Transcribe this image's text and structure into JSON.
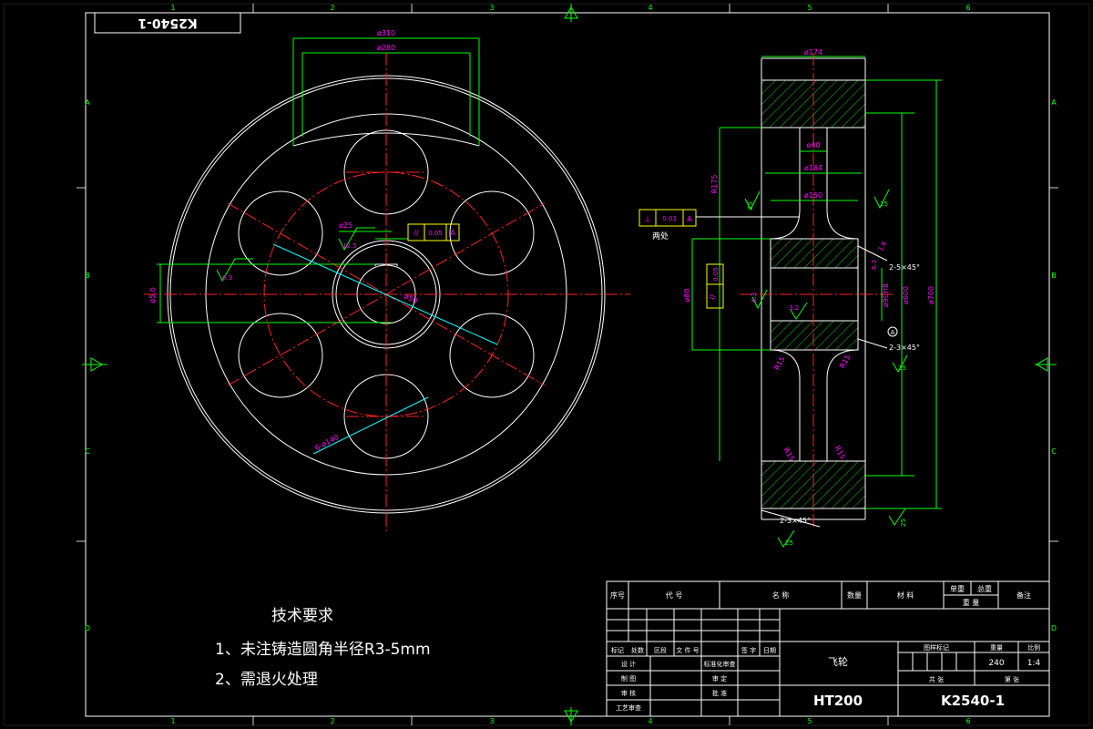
{
  "colors": {
    "background": "#000000",
    "outline": "#ffffff",
    "center": "#ff2020",
    "dimension": "#00ff00",
    "dim_text": "#ff00ff",
    "leader": "#00ffff",
    "symbol": "#ffff00",
    "hatch": "#00ff00"
  },
  "border": {
    "columns": [
      "1",
      "2",
      "3",
      "4",
      "5",
      "6"
    ],
    "rows": [
      "A",
      "B",
      "C",
      "D"
    ]
  },
  "drawing_code_box": "K2540-1",
  "front_view": {
    "dims": {
      "d310": "ø310",
      "d280": "ø280",
      "d25": "ø25",
      "d5_6": "ø5.6",
      "holes": "6-ø140",
      "d_center": "ø50"
    },
    "roughness": {
      "r12_5": "12.5",
      "r6_3": "6.3"
    },
    "tolerance_frame": [
      "//",
      "0.05",
      "A"
    ]
  },
  "section_view": {
    "dims": {
      "d174": "ø174",
      "d40": "ø40",
      "d164": "ø164",
      "d150": "ø150",
      "r175": "R175",
      "d90h8": "ø90H8",
      "d600": "ø600",
      "d700": "ø700",
      "d80": "ø80",
      "r15_a": "R15",
      "r15_b": "R15",
      "r15_c": "R15",
      "r15_d": "R15",
      "chamfer_a": "2-5×45°",
      "chamfer_b": "2-3×45°",
      "chamfer_c": "2-3×45°"
    },
    "roughness": {
      "r25_a": "25",
      "r25_b": "25",
      "r25_c": "25",
      "r25_d": "25",
      "r25_e": "25",
      "r3_2": "3.2",
      "r6_3": "6.3",
      "r6_3b": "6.3",
      "r1_6": "1.6"
    },
    "runout_frame": [
      "⊥",
      "0.03",
      "A"
    ],
    "runout_label": "两处",
    "parallel_frame": [
      "//",
      "0.05"
    ],
    "datum": "A"
  },
  "notes": {
    "title": "技术要求",
    "item1": "1、未注铸造圆角半径R3-5mm",
    "item2": "2、需退火处理"
  },
  "title_block": {
    "header": {
      "seq": "序号",
      "code": "代  号",
      "name": "名        称",
      "qty": "数量",
      "material": "材  料",
      "unit_weight": "单重",
      "total_weight": "总重",
      "weight": "重  量",
      "remark": "备注"
    },
    "revision": {
      "mark": "标记",
      "count": "处数",
      "zone": "区段",
      "doc": "文 件 号",
      "sign": "签  字",
      "date": "日期"
    },
    "roles": {
      "design": "设  计",
      "draw": "制  图",
      "check": "审  核",
      "process": "工艺审查",
      "standard": "标准化审查",
      "review": "审  定",
      "approve": "批  准"
    },
    "part_name": "飞轮",
    "material": "HT200",
    "drawing_number": "K2540-1",
    "stage_mark": "图样标记",
    "weight_label": "重量",
    "scale_label": "比例",
    "weight_value": "240",
    "scale_value": "1:4",
    "sheets_total": "共    张",
    "sheet_no": "第    张"
  }
}
